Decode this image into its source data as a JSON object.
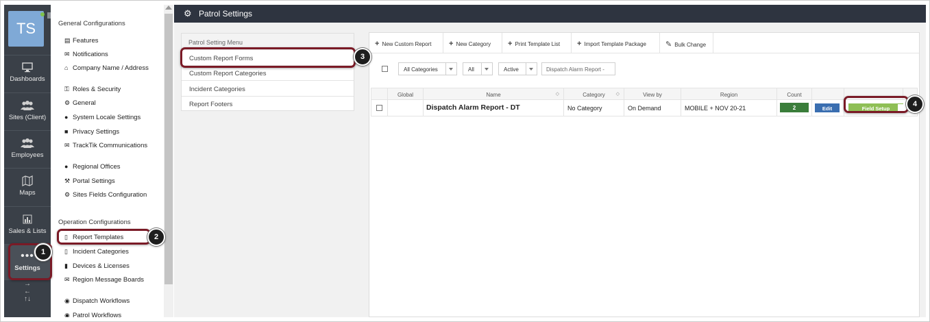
{
  "nav": {
    "avatar_initials": "TS",
    "items": [
      {
        "label": "Dashboards",
        "icon": "monitor-icon"
      },
      {
        "label": "Sites (Client)",
        "icon": "people-icon"
      },
      {
        "label": "Employees",
        "icon": "people-icon"
      },
      {
        "label": "Maps",
        "icon": "map-icon"
      },
      {
        "label": "Sales & Lists",
        "icon": "bar-chart-icon"
      },
      {
        "label": "Settings",
        "icon": "dots-icon"
      }
    ],
    "settings_dots": "•••",
    "arrows": [
      "→",
      "←",
      "↑↓"
    ]
  },
  "side_menu": {
    "general_heading": "General Configurations",
    "general_items": [
      {
        "label": "Features",
        "icon": "table-icon"
      },
      {
        "label": "Notifications",
        "icon": "envelope-icon"
      },
      {
        "label": "Company Name / Address",
        "icon": "home-icon"
      },
      {
        "label": "Roles & Security",
        "icon": "key-icon"
      },
      {
        "label": "General",
        "icon": "gear-icon"
      },
      {
        "label": "System Locale Settings",
        "icon": "globe-icon"
      },
      {
        "label": "Privacy Settings",
        "icon": "lock-icon"
      },
      {
        "label": "TrackTik Communications",
        "icon": "envelope-icon"
      },
      {
        "label": "Regional Offices",
        "icon": "globe-icon"
      },
      {
        "label": "Portal Settings",
        "icon": "wrench-icon"
      },
      {
        "label": "Sites Fields Configuration",
        "icon": "gear-icon"
      }
    ],
    "operation_heading": "Operation Configurations",
    "operation_items": [
      {
        "label": "Report Templates",
        "icon": "file-icon"
      },
      {
        "label": "Incident Categories",
        "icon": "file-icon"
      },
      {
        "label": "Devices & Licenses",
        "icon": "tablet-icon"
      },
      {
        "label": "Region Message Boards",
        "icon": "envelope-icon"
      },
      {
        "label": "Dispatch Workflows",
        "icon": "dispatch-icon"
      },
      {
        "label": "Patrol Workflows",
        "icon": "dispatch-icon"
      }
    ]
  },
  "header": {
    "title": "Patrol Settings",
    "icon": "gear-icon"
  },
  "patrol_menu": {
    "heading": "Patrol Setting Menu",
    "items": [
      "Custom Report Forms",
      "Custom Report Categories",
      "Incident Categories",
      "Report Footers"
    ]
  },
  "toolbar": {
    "buttons": [
      "New Custom Report",
      "New Category",
      "Print Template List",
      "Import Template Package",
      "Bulk Change"
    ],
    "plus_glyph": "+",
    "pencil_glyph": "✎"
  },
  "filters": {
    "category": "All Categories",
    "type": "All",
    "status": "Active",
    "search_placeholder": "Dispatch Alarm Report -"
  },
  "table": {
    "columns": [
      "Global",
      "Name",
      "Category",
      "View by",
      "Region",
      "Count"
    ],
    "row": {
      "name": "Dispatch Alarm Report - DT",
      "category": "No Category",
      "view_by": "On Demand",
      "region": "MOBILE + NOV 20-21",
      "count": "2",
      "edit_label": "Edit",
      "field_setup_label": "Field Setup"
    }
  },
  "callouts": [
    "1",
    "2",
    "3",
    "4"
  ],
  "colors": {
    "nav_bg": "#3a4048",
    "topbar_bg": "#2e3440",
    "callout_border": "#7a1a26",
    "count_green": "#3a7d3a",
    "edit_blue": "#3a6eb0",
    "field_setup_green": "#8fbf55"
  }
}
